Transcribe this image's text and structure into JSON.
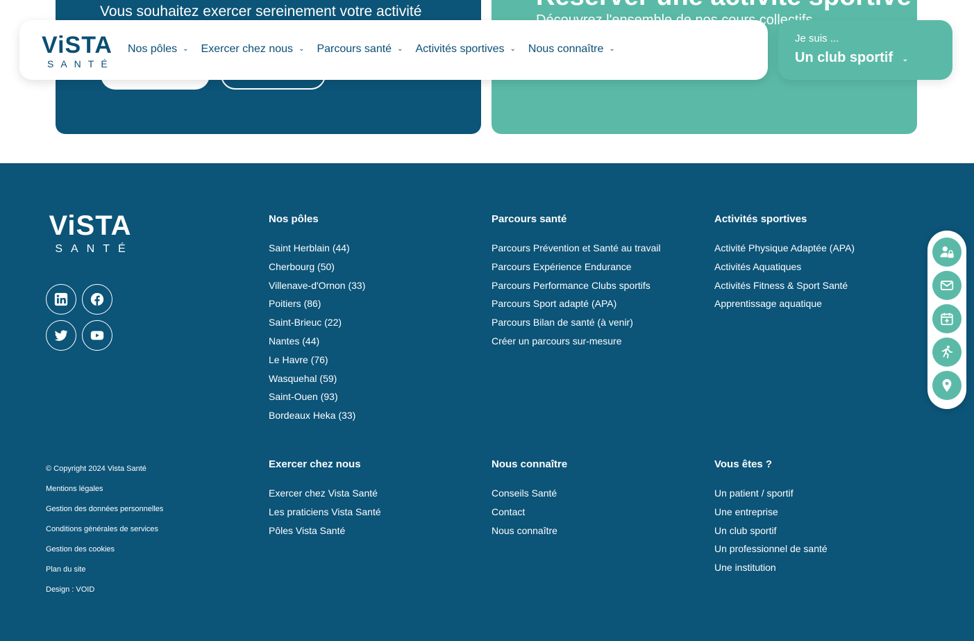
{
  "promo": {
    "left_headline": "Vous souhaitez exercer sereinement votre activité",
    "right_title": "Réserver une activité sportive",
    "right_subtitle": "Découvrez l'ensemble de nos cours collectifs"
  },
  "header": {
    "logo_main": "ViSTA",
    "logo_sub": "SANTÉ",
    "nav": [
      {
        "label": "Nos pôles"
      },
      {
        "label": "Exercer chez nous"
      },
      {
        "label": "Parcours santé"
      },
      {
        "label": "Activités sportives"
      },
      {
        "label": "Nous connaître"
      }
    ],
    "profile_prompt": "Je suis ...",
    "profile_value": "Un club sportif"
  },
  "footer": {
    "logo_main": "ViSTA",
    "logo_sub": "SANTÉ",
    "social_icons": [
      "linkedin-icon",
      "facebook-icon",
      "twitter-icon",
      "youtube-icon"
    ],
    "poles": {
      "title": "Nos pôles",
      "items": [
        "Saint Herblain (44)",
        "Cherbourg (50)",
        "Villenave-d'Ornon (33)",
        "Poitiers (86)",
        "Saint-Brieuc (22)",
        "Nantes (44)",
        "Le Havre (76)",
        "Wasquehal (59)",
        "Saint-Ouen (93)",
        "Bordeaux Heka (33)"
      ]
    },
    "parcours": {
      "title": "Parcours santé",
      "items": [
        "Parcours Prévention et Santé au travail",
        "Parcours Expérience Endurance",
        "Parcours Performance Clubs sportifs",
        "Parcours Sport adapté (APA)",
        "Parcours Bilan de santé (à venir)",
        "Créer un parcours sur-mesure"
      ]
    },
    "activites": {
      "title": "Activités sportives",
      "items": [
        "Activité Physique Adaptée (APA)",
        "Activités Aquatiques",
        "Activités Fitness & Sport Santé",
        "Apprentissage aquatique"
      ]
    },
    "exercer": {
      "title": "Exercer chez nous",
      "items": [
        "Exercer chez Vista Santé",
        "Les praticiens Vista Santé",
        "Pôles Vista Santé"
      ]
    },
    "connaitre": {
      "title": "Nous connaître",
      "items": [
        "Conseils Santé",
        "Contact",
        "Nous connaître"
      ]
    },
    "vous_etes": {
      "title": "Vous êtes ?",
      "items": [
        "Un patient / sportif",
        "Une entreprise",
        "Un club sportif",
        "Un professionnel de santé",
        "Une institution"
      ]
    },
    "legal": [
      "© Copyright 2024 Vista Santé",
      "Mentions légales",
      "Gestion des données personnelles",
      "Conditions générales de services",
      "Gestion des cookies",
      "Plan du site",
      "Design : VOID"
    ]
  },
  "quickbar": {
    "icons": [
      "user-lock-icon",
      "mail-icon",
      "calendar-plus-icon",
      "running-icon",
      "map-pin-icon"
    ]
  },
  "colors": {
    "brand_blue": "#0c5478",
    "brand_green": "#5bbaa7"
  }
}
